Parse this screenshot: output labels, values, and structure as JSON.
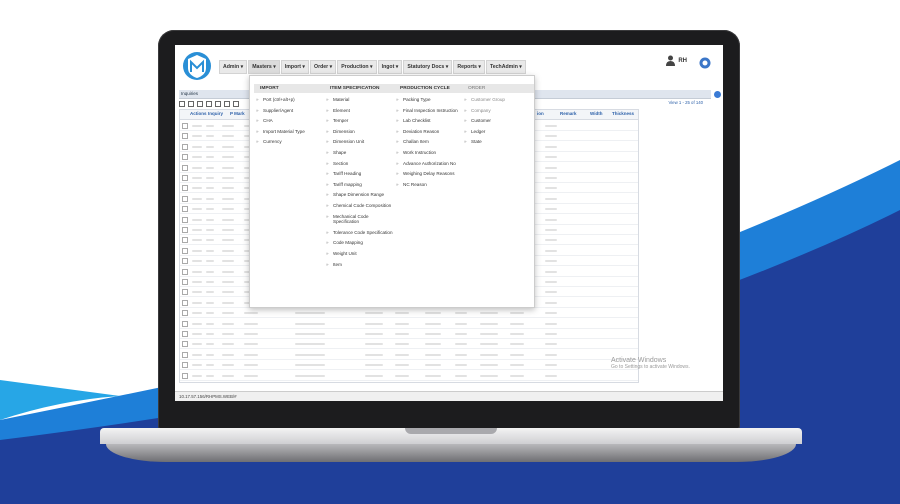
{
  "nav": {
    "items": [
      "Admin",
      "Masters",
      "Import",
      "Order",
      "Production",
      "Ingot",
      "Statutory Docs",
      "Reports",
      "TechAdmin"
    ]
  },
  "user": {
    "initials": "RH"
  },
  "section": {
    "title": "Inquiries"
  },
  "grid": {
    "view_count": "View 1 - 25 of 140",
    "columns": [
      "Actions",
      "Inquiry",
      "P Mark",
      "ion",
      "Remark",
      "Width",
      "Thickness"
    ]
  },
  "menu": {
    "import": {
      "header": "IMPORT",
      "items": [
        "Port  (ctrl+alt+p)",
        "Supplier/Agent",
        "CHA",
        "Import Material Type",
        "Currency"
      ]
    },
    "item_spec": {
      "header": "ITEM SPECIFICATION",
      "items": [
        "Material",
        "Element",
        "Temper",
        "Dimension",
        "Dimension Unit",
        "Shape",
        "Section",
        "Tariff Heading",
        "Tariff mapping",
        "Shape Dimension Range",
        "Chemical Code Composition",
        "Mechanical Code Specification",
        "Tolerance Code Specification",
        "Code Mapping",
        "Weight Unit",
        "Item"
      ]
    },
    "production": {
      "header": "PRODUCTION CYCLE",
      "items": [
        "Packing Type",
        "Final Inspection Instruction",
        "Lab Checklist",
        "Deviation Reason",
        "Challan Item",
        "Work Instruction",
        "Advance Authorization No",
        "Weighing Delay Reasons",
        "NC Reason"
      ]
    },
    "order": {
      "header": "ORDER",
      "items": [
        "Customer Group",
        "Company",
        "Customer",
        "Ledger",
        "State"
      ]
    }
  },
  "status": {
    "url": "10.17.57.156/RHPMS.WEB/#"
  },
  "watermark": {
    "line1": "Activate Windows",
    "line2": "Go to Settings to activate Windows."
  },
  "colors": {
    "accent": "#2b5fa8",
    "brand_blue": "#1f3f9a",
    "brand_light": "#1e7fd8"
  }
}
